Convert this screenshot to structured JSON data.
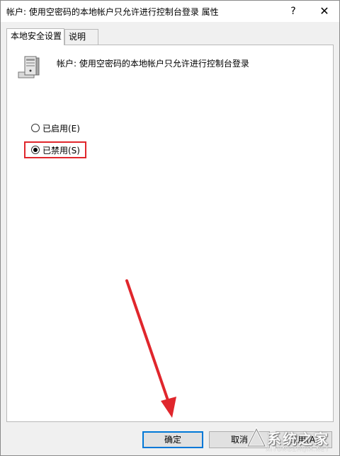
{
  "window": {
    "title": "帐户: 使用空密码的本地帐户只允许进行控制台登录 属性",
    "help_label": "?",
    "close_label": "✕"
  },
  "tabs": [
    {
      "label": "本地安全设置",
      "active": true
    },
    {
      "label": "说明",
      "active": false
    }
  ],
  "policy": {
    "name": "帐户: 使用空密码的本地帐户只允许进行控制台登录",
    "icon": "server-computer-icon"
  },
  "options": [
    {
      "label": "已启用(E)",
      "checked": false
    },
    {
      "label": "已禁用(S)",
      "checked": true
    }
  ],
  "buttons": {
    "ok": "确定",
    "cancel": "取消",
    "apply": "应用(A)"
  },
  "annotations": {
    "highlight_color": "#e0262c",
    "arrow_color": "#e0262c"
  },
  "watermark": {
    "text": "系统之家",
    "sub": "XITONGZHIJIA.NET"
  }
}
